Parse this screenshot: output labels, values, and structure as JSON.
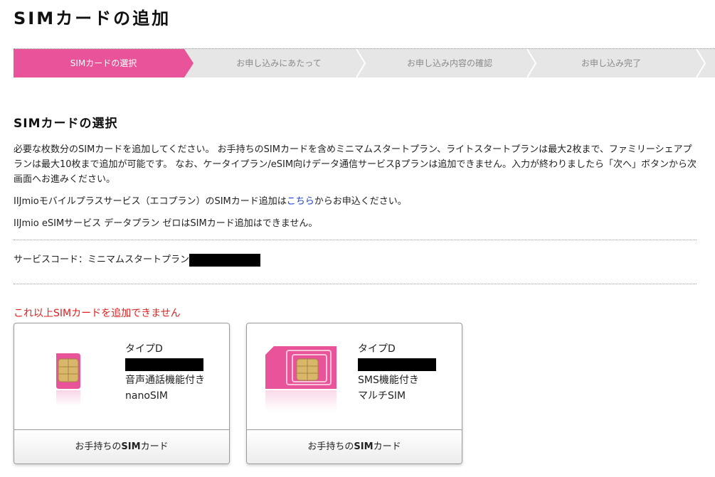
{
  "page": {
    "title": "SIMカードの追加"
  },
  "steps": [
    {
      "label": "SIMカードの選択",
      "active": true
    },
    {
      "label": "お申し込みにあたって",
      "active": false
    },
    {
      "label": "お申し込み内容の確認",
      "active": false
    },
    {
      "label": "お申し込み完了",
      "active": false
    }
  ],
  "section": {
    "title": "SIMカードの選択",
    "description": "必要な枚数分のSIMカードを追加してください。 お手持ちのSIMカードを含めミニマムスタートプラン、ライトスタートプランは最大2枚まで、ファミリーシェアプランは最大10枚まで追加が可能です。 なお、ケータイプラン/eSIM向けデータ通信サービスβプランは追加できません。入力が終わりましたら「次へ」ボタンから次画面へお進みください。",
    "eco_before": "IIJmioモバイルプラスサービス（エコプラン）のSIMカード追加は",
    "eco_link": "こちら",
    "eco_after": "からお申込ください。",
    "esim_note": "IIJmio eSIMサービス データプラン ゼロはSIMカード追加はできません。",
    "service_code_label": "サービスコード：ミニマムスタートプラン"
  },
  "warning": "これ以上SIMカードを追加できません",
  "cards": [
    {
      "type": "タイプD",
      "feature": "音声通話機能付き",
      "size": "nanoSIM",
      "footer_prefix": "お手持ちの",
      "footer_bold": "SIM",
      "footer_suffix": "カード",
      "image": "nano-sim-icon"
    },
    {
      "type": "タイプD",
      "feature": "SMS機能付き",
      "size": "マルチSIM",
      "footer_prefix": "お手持ちの",
      "footer_bold": "SIM",
      "footer_suffix": "カード",
      "image": "multi-sim-icon"
    }
  ],
  "colors": {
    "accent": "#e8539a",
    "warning": "#e01e1e",
    "link": "#1a3fcc",
    "stepbar_bg": "#e6e6e6"
  }
}
